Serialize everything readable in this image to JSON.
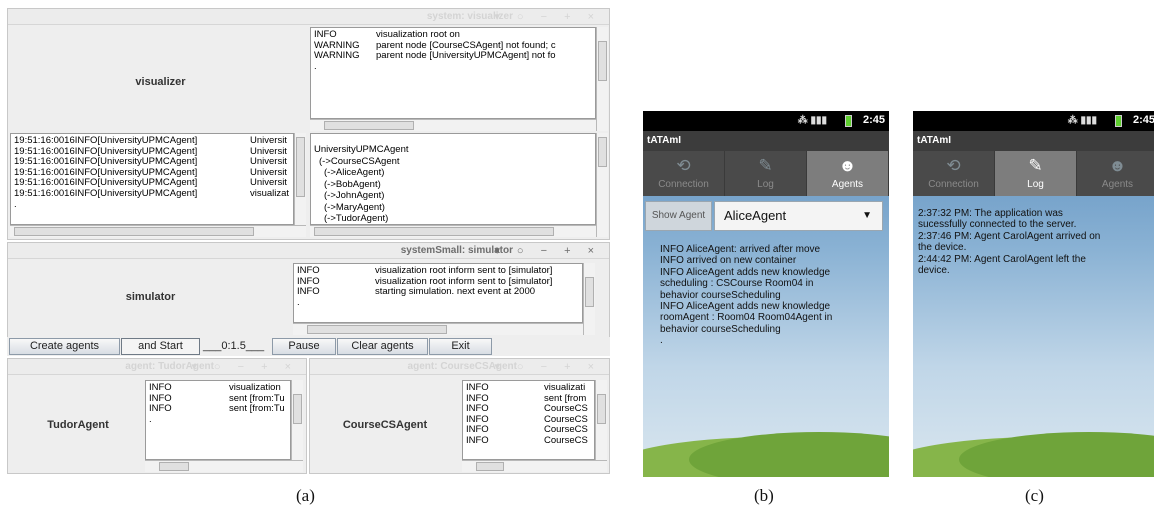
{
  "figure_a": {
    "caption": "(a)",
    "visualizer": {
      "title": "system: visualizer",
      "controls": "▾ ○ − + ×",
      "agent_label": "visualizer",
      "top_log": [
        {
          "level": "INFO",
          "msg": "visualization root on"
        },
        {
          "level": "WARNING",
          "msg": "parent node [CourseCSAgent] not found; c"
        },
        {
          "level": "WARNING",
          "msg": "parent node [UniversityUPMCAgent] not fo"
        },
        {
          "level": ".",
          "msg": ""
        }
      ],
      "left_log": [
        {
          "level": "19:51:16:0016INFO[UniversityUPMCAgent]",
          "msg": "Universit"
        },
        {
          "level": "19:51:16:0016INFO[UniversityUPMCAgent]",
          "msg": "Universit"
        },
        {
          "level": "19:51:16:0016INFO[UniversityUPMCAgent]",
          "msg": "Universit"
        },
        {
          "level": "19:51:16:0016INFO[UniversityUPMCAgent]",
          "msg": "Universit"
        },
        {
          "level": "19:51:16:0016INFO[UniversityUPMCAgent]",
          "msg": "Universit"
        },
        {
          "level": "19:51:16:0016INFO[UniversityUPMCAgent]",
          "msg": "visualizat"
        },
        {
          "level": ".",
          "msg": ""
        }
      ],
      "tree": [
        "UniversityUPMCAgent",
        "(->CourseCSAgent",
        "(->AliceAgent)",
        "(->BobAgent)",
        "(->JohnAgent)",
        "(->MaryAgent)",
        "(->TudorAgent)"
      ]
    },
    "simulator": {
      "title": "systemSmall: simulator",
      "controls": "▾ ○ − + ×",
      "agent_label": "simulator",
      "log": [
        {
          "level": "INFO",
          "msg": "visualization root inform sent to [simulator]"
        },
        {
          "level": "INFO",
          "msg": "visualization root inform sent to [simulator]"
        },
        {
          "level": "INFO",
          "msg": "starting simulation. next event at 2000"
        },
        {
          "level": ".",
          "msg": ""
        }
      ]
    },
    "toolbar": {
      "create_agents": "Create agents",
      "and_start": "and Start",
      "time_value": "___0:1.5___",
      "pause": "Pause",
      "clear_agents": "Clear agents",
      "exit": "Exit"
    },
    "tudor": {
      "title": "agent: TudorAgent",
      "controls": "▾ ○ − + ×",
      "agent_label": "TudorAgent",
      "log": [
        {
          "level": "INFO",
          "msg": "visualization"
        },
        {
          "level": "INFO",
          "msg": "sent [from:Tu"
        },
        {
          "level": "INFO",
          "msg": "sent [from:Tu"
        },
        {
          "level": ".",
          "msg": ""
        }
      ]
    },
    "coursecs": {
      "title": "agent: CourseCSAgent",
      "controls": "▾ ○ − + ×",
      "agent_label": "CourseCSAgent",
      "log": [
        {
          "level": "INFO",
          "msg": "visualizati"
        },
        {
          "level": "INFO",
          "msg": "sent [from"
        },
        {
          "level": "INFO",
          "msg": "CourseCS"
        },
        {
          "level": "INFO",
          "msg": "CourseCS"
        },
        {
          "level": "INFO",
          "msg": "CourseCS"
        },
        {
          "level": "INFO",
          "msg": "CourseCS"
        }
      ]
    }
  },
  "figure_b": {
    "caption": "(b)",
    "time": "2:45",
    "app_title": "tATAmI",
    "tabs": [
      "Connection",
      "Log",
      "Agents"
    ],
    "selected_tab": "Agents",
    "show_agent_button": "Show Agent",
    "agent_select": "AliceAgent",
    "log_lines": [
      "INFO  AliceAgent: arrived after move",
      "INFO  arrived on new container",
      "INFO  AliceAgent adds new knowledge",
      "scheduling : CSCourse Room04  in",
      "behavior courseScheduling",
      "INFO  AliceAgent adds new knowledge",
      "roomAgent : Room04 Room04Agent  in",
      "behavior courseScheduling",
      "."
    ]
  },
  "figure_c": {
    "caption": "(c)",
    "time": "2:45",
    "app_title": "tATAmI",
    "tabs": [
      "Connection",
      "Log",
      "Agents"
    ],
    "selected_tab": "Log",
    "log_lines": [
      "2:37:32 PM: The application was",
      "sucessfully connected to the server.",
      "2:37:46 PM: Agent CarolAgent arrived on",
      "the device.",
      "2:44:42 PM: Agent CarolAgent left the",
      "device."
    ]
  },
  "colors": {
    "phone_tab_bar": "#4a4a4a",
    "phone_selected_tab": "#7d7d7d",
    "grass": "#86b54a",
    "sky": "#5a8dbd"
  },
  "icons": {
    "connection": "connection-icon",
    "log": "pencil-icon",
    "agents": "agents-icon"
  }
}
